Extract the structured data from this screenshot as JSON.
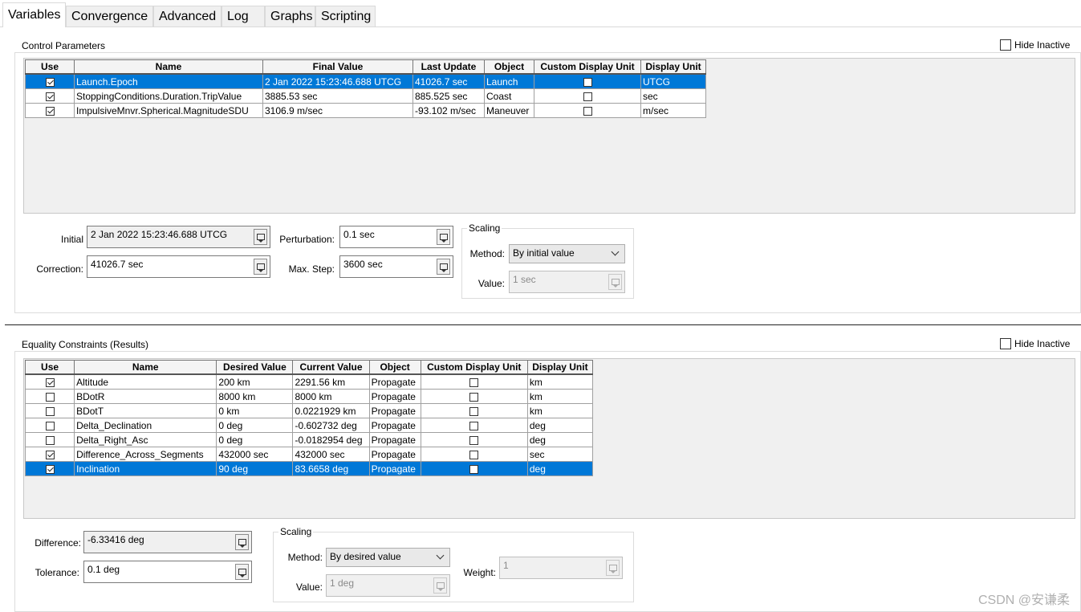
{
  "tabs": [
    "Variables",
    "Convergence",
    "Advanced",
    "Log",
    "Graphs",
    "Scripting"
  ],
  "control": {
    "title": "Control Parameters",
    "hide_inactive": "Hide Inactive",
    "columns": [
      "Use",
      "Name",
      "Final Value",
      "Last Update",
      "Object",
      "Custom Display Unit",
      "Display Unit"
    ],
    "rows": [
      {
        "use": true,
        "name": "Launch.Epoch",
        "final": "2 Jan 2022 15:23:46.688 UTCG",
        "last": "41026.7 sec",
        "object": "Launch",
        "custom": false,
        "unit": "UTCG",
        "selected": true
      },
      {
        "use": true,
        "name": "StoppingConditions.Duration.TripValue",
        "final": "3885.53 sec",
        "last": "885.525 sec",
        "object": "Coast",
        "custom": false,
        "unit": "sec",
        "selected": false
      },
      {
        "use": true,
        "name": "ImpulsiveMnvr.Spherical.MagnitudeSDU",
        "final": "3106.9 m/sec",
        "last": "-93.102 m/sec",
        "object": "Maneuver",
        "custom": false,
        "unit": "m/sec",
        "selected": false
      }
    ],
    "initial_label": "Initial",
    "initial_value": "2 Jan 2022 15:23:46.688 UTCG",
    "correction_label": "Correction:",
    "correction_value": "41026.7 sec",
    "perturbation_label": "Perturbation:",
    "perturbation_value": "0.1 sec",
    "maxstep_label": "Max. Step:",
    "maxstep_value": "3600 sec",
    "scaling_title": "Scaling",
    "method_label": "Method:",
    "method_value": "By initial value",
    "value_label": "Value:",
    "value_value": "1 sec"
  },
  "equality": {
    "title": "Equality Constraints (Results)",
    "hide_inactive": "Hide Inactive",
    "columns": [
      "Use",
      "Name",
      "Desired Value",
      "Current Value",
      "Object",
      "Custom Display Unit",
      "Display Unit"
    ],
    "rows": [
      {
        "use": true,
        "name": "Altitude",
        "desired": "200 km",
        "current": "2291.56 km",
        "object": "Propagate",
        "custom": false,
        "unit": "km",
        "selected": false
      },
      {
        "use": false,
        "name": "BDotR",
        "desired": "8000 km",
        "current": "8000 km",
        "object": "Propagate",
        "custom": false,
        "unit": "km",
        "selected": false
      },
      {
        "use": false,
        "name": "BDotT",
        "desired": "0 km",
        "current": "0.0221929 km",
        "object": "Propagate",
        "custom": false,
        "unit": "km",
        "selected": false
      },
      {
        "use": false,
        "name": "Delta_Declination",
        "desired": "0 deg",
        "current": "-0.602732 deg",
        "object": "Propagate",
        "custom": false,
        "unit": "deg",
        "selected": false
      },
      {
        "use": false,
        "name": "Delta_Right_Asc",
        "desired": "0 deg",
        "current": "-0.0182954 deg",
        "object": "Propagate",
        "custom": false,
        "unit": "deg",
        "selected": false
      },
      {
        "use": true,
        "name": "Difference_Across_Segments",
        "desired": "432000 sec",
        "current": "432000 sec",
        "object": "Propagate",
        "custom": false,
        "unit": "sec",
        "selected": false
      },
      {
        "use": true,
        "name": "Inclination",
        "desired": "90 deg",
        "current": "83.6658 deg",
        "object": "Propagate",
        "custom": false,
        "unit": "deg",
        "selected": true
      }
    ],
    "difference_label": "Difference:",
    "difference_value": "-6.33416 deg",
    "tolerance_label": "Tolerance:",
    "tolerance_value": "0.1 deg",
    "scaling_title": "Scaling",
    "method_label": "Method:",
    "method_value": "By desired value",
    "value_label": "Value:",
    "value_value": "1 deg",
    "weight_label": "Weight:",
    "weight_value": "1"
  },
  "watermark": "CSDN @安谦柔"
}
